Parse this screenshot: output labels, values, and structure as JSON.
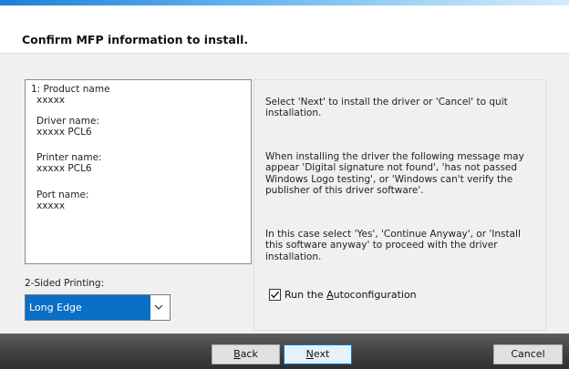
{
  "header": {
    "title": "Confirm MFP information to install."
  },
  "info": {
    "product_label": "1: Product name",
    "product_value": "xxxxx",
    "driver_label": "Driver name:",
    "driver_value": "xxxxx PCL6",
    "printer_label": "Printer name:",
    "printer_value": "xxxxx PCL6",
    "port_label": "Port name:",
    "port_value": "xxxxx"
  },
  "two_sided": {
    "label": "2-Sided Printing:",
    "selected": "Long Edge"
  },
  "messages": {
    "next_cancel": "Select 'Next' to install the driver or 'Cancel' to quit installation.",
    "warning": "When installing the driver the following message may appear 'Digital signature not found', 'has not passed Windows Logo testing', or 'Windows can't verify the publisher of this driver software'.",
    "instruction": "In this case select 'Yes', 'Continue Anyway', or 'Install this software anyway' to proceed with the driver installation."
  },
  "autoconfig": {
    "label_prefix": "Run the ",
    "label_accel": "A",
    "label_suffix": "utoconfiguration",
    "checked": true
  },
  "buttons": {
    "back_accel": "B",
    "back_rest": "ack",
    "next_accel": "N",
    "next_rest": "ext",
    "cancel": "Cancel"
  },
  "icons": {
    "chevron": "chevron-down-icon",
    "check": "checkmark-icon"
  },
  "colors": {
    "accent": "#0a6fc7",
    "footer": "#3a3a3a",
    "focus_border": "#0078d7"
  }
}
